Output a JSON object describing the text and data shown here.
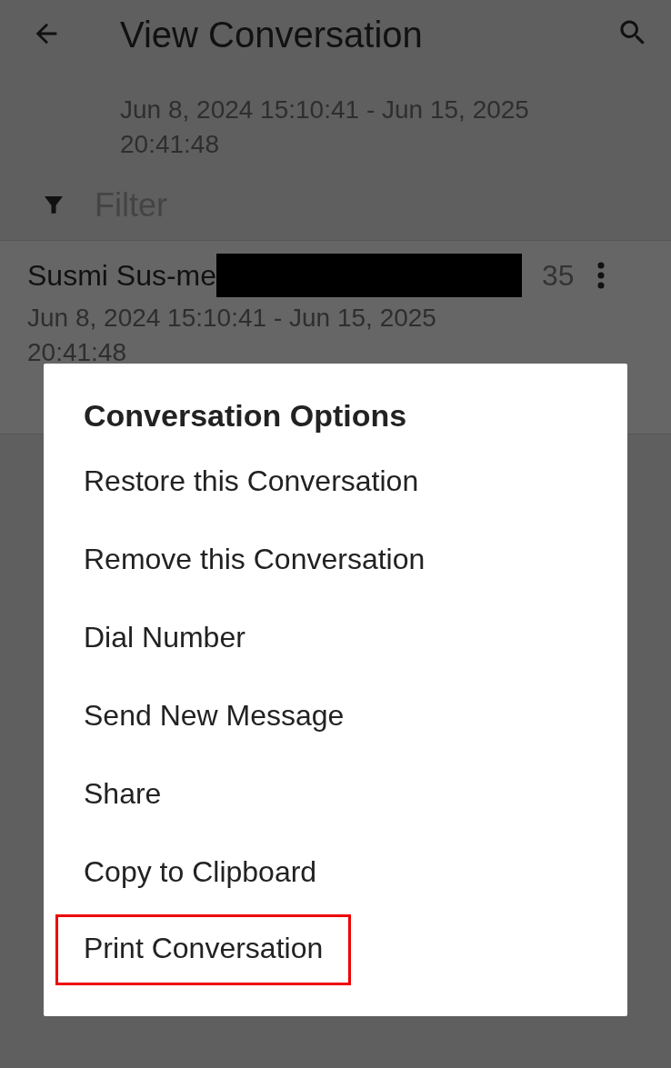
{
  "toolbar": {
    "title": "View Conversation",
    "subtitle": "Jun 8, 2024 15:10:41 - Jun 15, 2025 20:41:48"
  },
  "filter": {
    "placeholder": "Filter"
  },
  "conversation": {
    "name": "Susmi Sus-me",
    "count": "35",
    "date_range": "Jun 8, 2024 15:10:41 - Jun 15, 2025 20:41:48"
  },
  "dialog": {
    "title": "Conversation Options",
    "options": [
      {
        "label": "Restore this Conversation",
        "highlighted": false
      },
      {
        "label": "Remove this Conversation",
        "highlighted": false
      },
      {
        "label": "Dial Number",
        "highlighted": false
      },
      {
        "label": "Send New Message",
        "highlighted": false
      },
      {
        "label": "Share",
        "highlighted": false
      },
      {
        "label": "Copy to Clipboard",
        "highlighted": false
      },
      {
        "label": "Print Conversation",
        "highlighted": true
      }
    ]
  }
}
